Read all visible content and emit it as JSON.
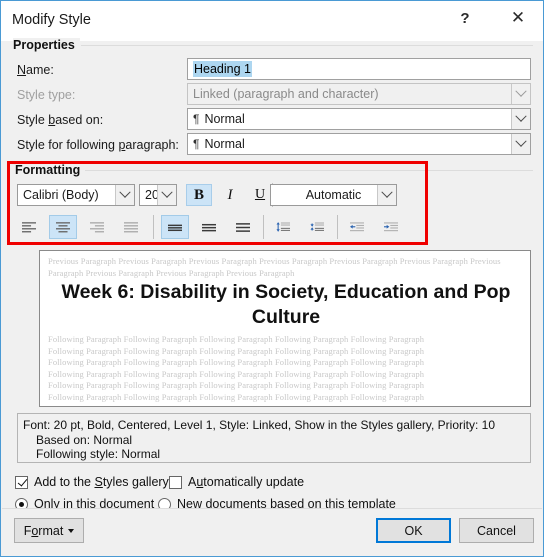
{
  "window": {
    "title": "Modify Style",
    "help_icon": "question-mark-icon",
    "close_icon": "close-icon"
  },
  "properties": {
    "group_label": "Properties",
    "fields": [
      {
        "label_pre": "N",
        "label_key": "a",
        "label_post": "me:",
        "label_full": "Name:",
        "value": "Heading 1",
        "type": "textbox",
        "selected": true,
        "disabled": false
      },
      {
        "label_full": "Style type:",
        "value": "Linked (paragraph and character)",
        "type": "combo",
        "disabled": true
      },
      {
        "label_full": "Style based on:",
        "value": "Normal",
        "type": "combo",
        "disabled": false,
        "pilcrow": true
      },
      {
        "label_full": "Style for following paragraph:",
        "value": "Normal",
        "type": "combo",
        "disabled": false,
        "pilcrow": true
      }
    ]
  },
  "formatting": {
    "group_label": "Formatting",
    "font_family": "Calibri (Body)",
    "font_size": "20",
    "font_color": "Automatic",
    "bold_label": "B",
    "italic_label": "I",
    "underline_label": "U",
    "bold_active": true,
    "align_buttons": [
      {
        "name": "align-left-icon",
        "active": false
      },
      {
        "name": "align-center-icon",
        "active": true
      },
      {
        "name": "align-right-icon",
        "active": false
      },
      {
        "name": "align-justify-icon",
        "active": false
      }
    ],
    "spacing_buttons": [
      {
        "name": "line-spacing-single-icon",
        "active": true
      },
      {
        "name": "line-spacing-1-5-icon",
        "active": false
      },
      {
        "name": "line-spacing-double-icon",
        "active": false
      }
    ],
    "paragraph_space_buttons": [
      {
        "name": "increase-paragraph-spacing-icon",
        "active": false
      },
      {
        "name": "decrease-paragraph-spacing-icon",
        "active": false
      }
    ],
    "indent_buttons": [
      {
        "name": "decrease-indent-icon",
        "active": false
      },
      {
        "name": "increase-indent-icon",
        "active": false
      }
    ]
  },
  "preview": {
    "previous_paragraph": "Previous Paragraph Previous Paragraph Previous Paragraph Previous Paragraph Previous Paragraph Previous Paragraph Previous Paragraph Previous Paragraph Previous Paragraph Previous Paragraph",
    "heading_text": "Week 6: Disability in Society, Education and Pop Culture",
    "following_paragraph_line": "Following Paragraph Following Paragraph Following Paragraph Following Paragraph Following Paragraph",
    "following_paragraph_lines": 6
  },
  "description": {
    "line1": "Font: 20 pt, Bold, Centered, Level 1, Style: Linked, Show in the Styles gallery, Priority: 10",
    "line2": "Based on: Normal",
    "line3": "Following style: Normal"
  },
  "options": {
    "add_to_gallery": {
      "label": "Add to the Styles gallery",
      "checked": true
    },
    "auto_update": {
      "label": "Automatically update",
      "checked": false
    },
    "only_this_document": {
      "label": "Only in this document",
      "selected": true
    },
    "new_documents": {
      "label": "New documents based on this template",
      "selected": false
    }
  },
  "buttons": {
    "format": "Format",
    "ok": "OK",
    "cancel": "Cancel"
  },
  "colors": {
    "accent": "#0078d7",
    "highlight_box": "#ef0000",
    "selection": "#add6f0",
    "active_tool": "#cce4f7"
  }
}
